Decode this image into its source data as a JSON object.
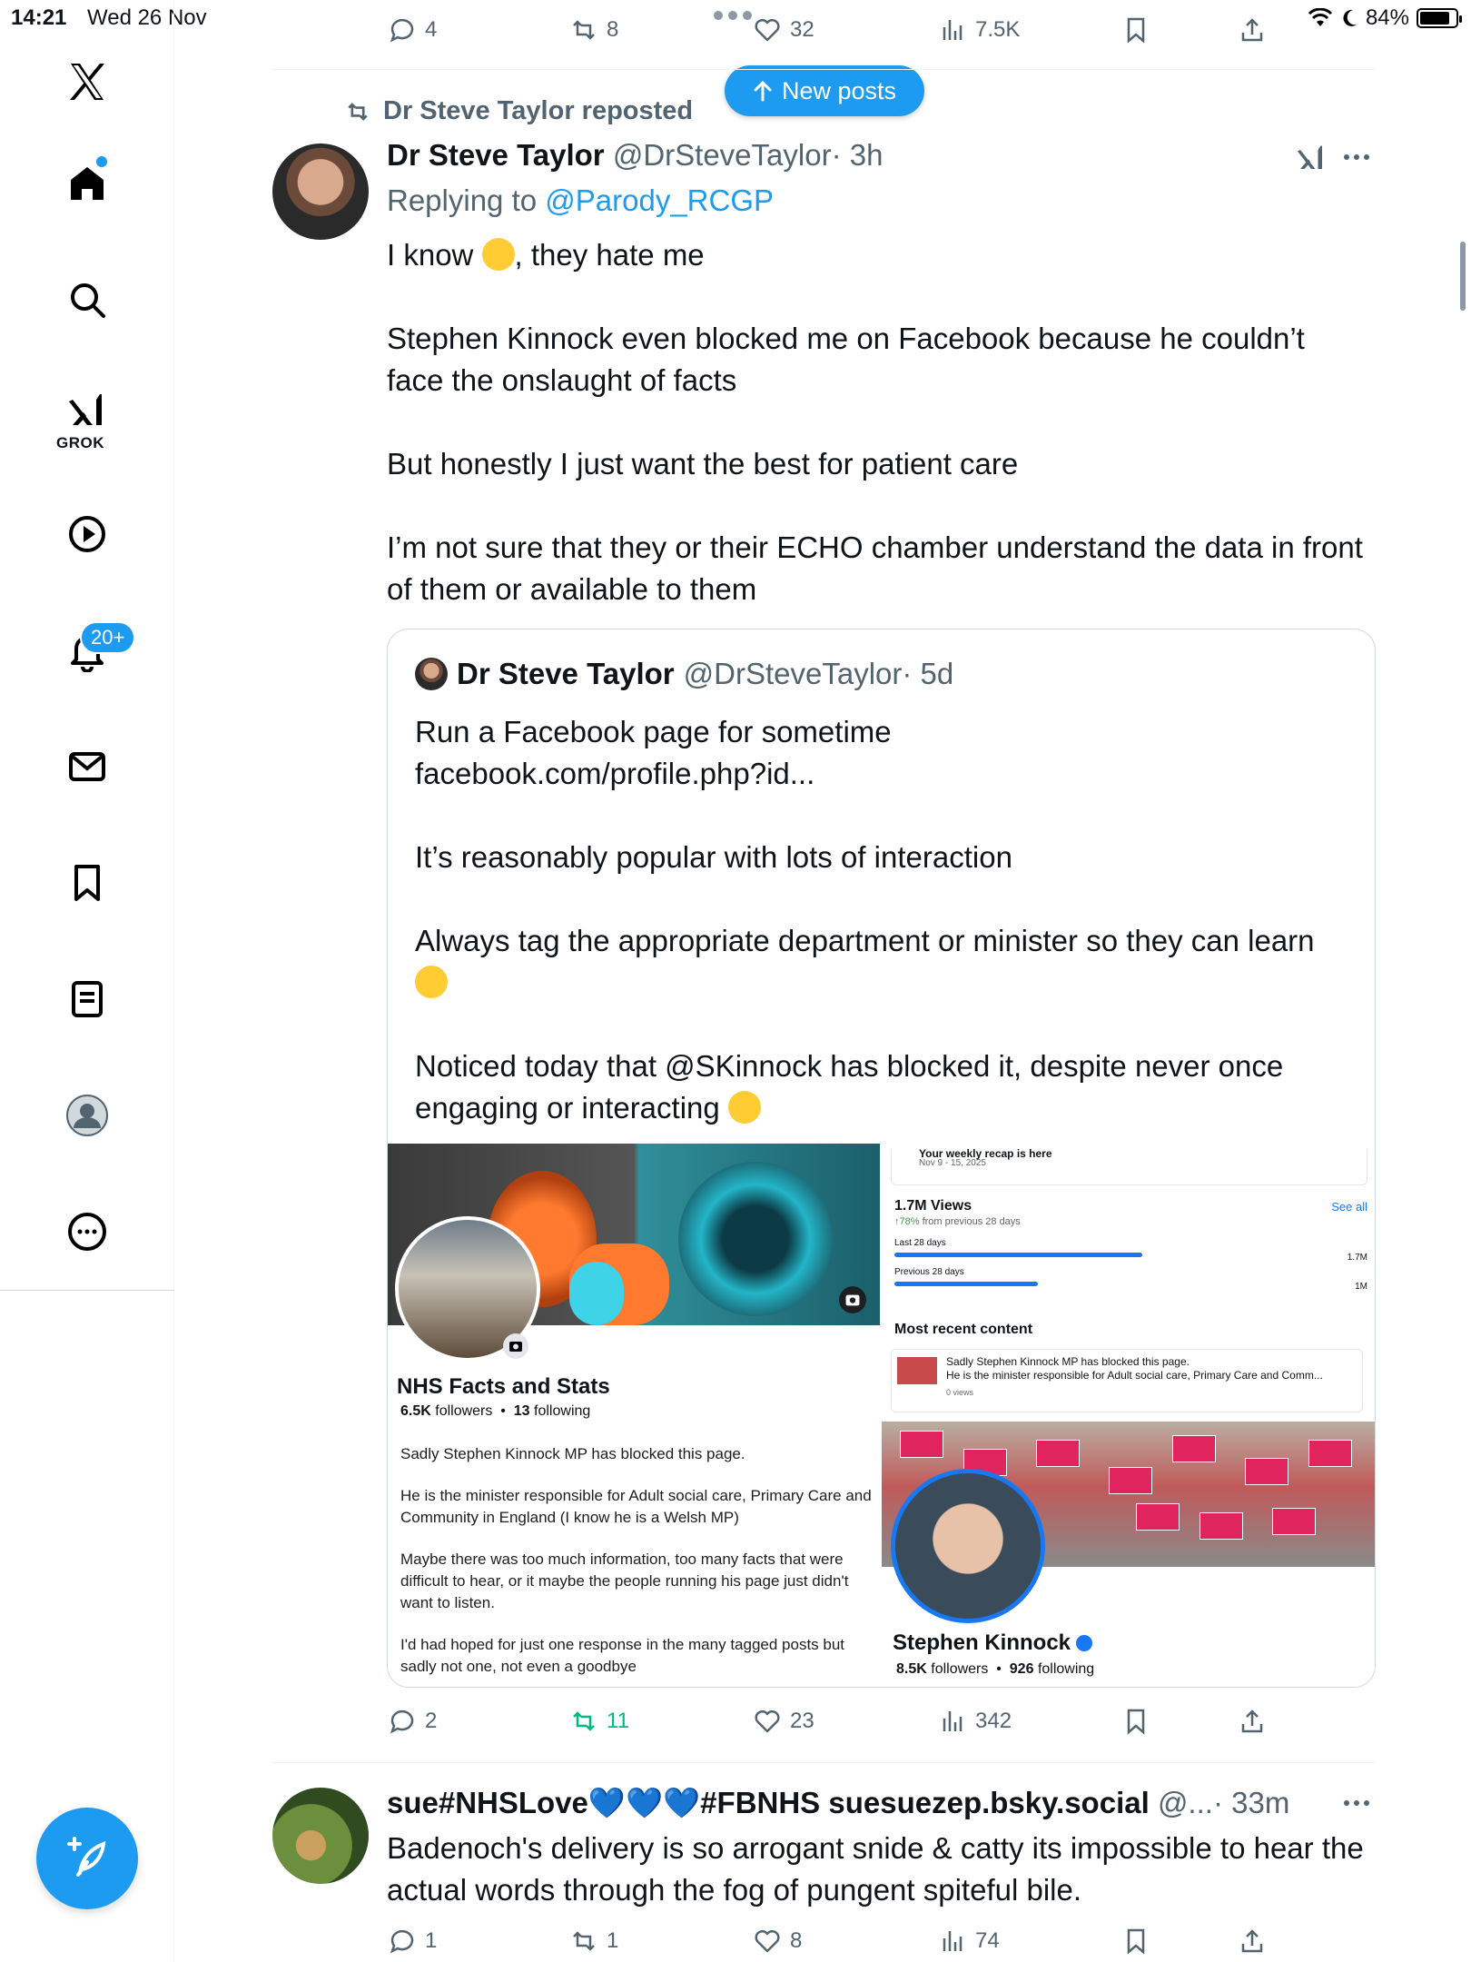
{
  "status_bar": {
    "time": "14:21",
    "date": "Wed 26 Nov",
    "battery": "84%",
    "battery_level": 0.84
  },
  "sidebar": {
    "grok_label": "GROK",
    "notifications_badge": "20+"
  },
  "top_actions": {
    "replies": "4",
    "reposts": "8",
    "likes": "32",
    "views": "7.5K"
  },
  "new_posts_label": "New posts",
  "post1": {
    "repost_by": "Dr Steve Taylor reposted",
    "author_name": "Dr Steve Taylor",
    "author_handle": "@DrSteveTaylor",
    "time": "· 3h",
    "replying_prefix": "Replying to ",
    "replying_to": "@Parody_RCGP",
    "line1_a": "I know ",
    "line1_b": ", they hate me",
    "para2": "Stephen Kinnock even blocked me on Facebook because he couldn’t face the onslaught of facts",
    "para3": "But honestly I just want the best for patient care",
    "para4": "I’m not sure that they or their ECHO chamber understand the data in front of them or available to them",
    "actions": {
      "replies": "2",
      "reposts": "11",
      "likes": "23",
      "views": "342"
    }
  },
  "quote": {
    "author_name": "Dr Steve Taylor",
    "author_handle": "@DrSteveTaylor",
    "time": "· 5d",
    "line1": "Run a Facebook page for sometime",
    "line2": "facebook.com/profile.php?id...",
    "para2": "It’s reasonably popular with lots of interaction",
    "para3": "Always tag the appropriate department or minister so they can learn",
    "para4": "Noticed today that @SKinnock has blocked it, despite never once engaging or interacting ",
    "fb_left": {
      "page_name": "NHS Facts and Stats",
      "followers_count": "6.5K",
      "followers_label": "followers",
      "following_count": "13",
      "following_label": "following",
      "post_p1": "Sadly Stephen Kinnock MP has blocked this page.",
      "post_p2": "He is the minister responsible for Adult social care, Primary Care and Community in England (I know he is a Welsh MP)",
      "post_p3": "Maybe there was too much information, too many facts that were difficult to hear, or it maybe the people running his page just didn't want to listen.",
      "post_p4": "I'd had hoped for just one response in the many tagged posts but sadly not one, not even a goodbye"
    },
    "fb_right": {
      "recap_title": "Your weekly recap is here",
      "recap_dates": "Nov 9 - 15, 2025",
      "views_title": "1.7M Views",
      "views_change": "↑78%",
      "views_change_suffix": " from previous 28 days",
      "see_all": "See all",
      "last_28_label": "Last 28 days",
      "last_28_value": "1.7M",
      "prev_28_label": "Previous 28 days",
      "prev_28_value": "1M",
      "last_28_fraction": 0.62,
      "prev_28_fraction": 0.36,
      "recent_title": "Most recent content",
      "recent_line1": "Sadly Stephen Kinnock MP has blocked this page.",
      "recent_line2": "He is the minister responsible for Adult social care, Primary Care and Comm...",
      "recent_views": "0 views",
      "profile_name": "Stephen Kinnock",
      "followers_count": "8.5K",
      "followers_label": "followers",
      "following_count": "926",
      "following_label": "following"
    }
  },
  "post2": {
    "author_name": "sue#NHSLove💙💙💙#FBNHS suesuezep.bsky.social",
    "author_handle": "@...",
    "time": "· 33m",
    "text": "Badenoch's delivery is so arrogant snide & catty its impossible to hear the actual words through the fog of pungent spiteful bile.",
    "actions": {
      "replies": "1",
      "reposts": "1",
      "likes": "8",
      "views": "74"
    }
  },
  "colors": {
    "accent": "#1d9bf0",
    "repost_green": "#00ba7c",
    "secondary_text": "#536471"
  }
}
